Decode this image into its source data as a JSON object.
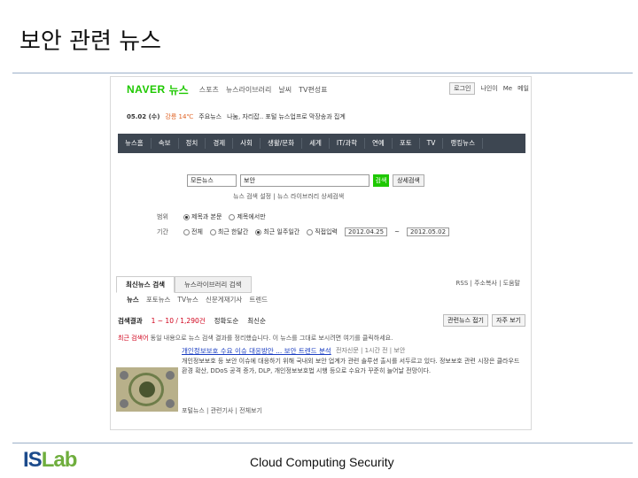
{
  "slide": {
    "title": "보안 관련 뉴스",
    "footer": "Cloud Computing Security",
    "logo_parts": [
      "IS",
      "Lab"
    ]
  },
  "naver": {
    "brand": "NAVER",
    "section": "뉴스",
    "top_nav": [
      "스포츠",
      "뉴스라이브러리",
      "날씨",
      "TV편성표"
    ],
    "top_right": [
      "로그인",
      "나인이",
      "Me",
      "메일"
    ],
    "date": "05.02 (수)",
    "weather_label": "강릉 14℃",
    "headline_prefix": "주요뉴스",
    "headline": "나눔, 자리잡.. 포털 뉴스업프로 막장송과 집계",
    "main_nav": [
      "뉴스홈",
      "속보",
      "정치",
      "경제",
      "사회",
      "생활/문화",
      "세계",
      "IT/과학",
      "연예",
      "포토",
      "TV",
      "랭킹뉴스"
    ],
    "search": {
      "scope": "모든뉴스",
      "query": "보안",
      "search_label": "검색",
      "detail_label": "상세검색",
      "links": "뉴스 검색 설정 | 뉴스 라이브러리 상세검색"
    },
    "filters": {
      "range_label": "범위",
      "range_options": [
        "제목과 본문",
        "제목에서만"
      ],
      "period_label": "기간",
      "period_options": [
        "전체",
        "최근 한달간",
        "최근 일주일간",
        "직접입력"
      ],
      "date_from": "2012.04.25",
      "date_sep": "~",
      "date_to": "2012.05.02"
    },
    "tabs": [
      "최신뉴스 검색",
      "뉴스라이브러리 검색"
    ],
    "tabs_right": "RSS | 주소복사 | 도움말",
    "subtabs": [
      "뉴스",
      "포토뉴스",
      "TV뉴스",
      "신문게재기사",
      "트렌드"
    ],
    "results": {
      "label": "검색결과",
      "count": "1 ~ 10 / 1,290건",
      "sort1": "정확도순",
      "sort2": "최신순",
      "buttons": [
        "관련뉴스 접기",
        "자주 보기"
      ]
    },
    "notice": {
      "highlight": "최근 검색어",
      "text": "동일 내용으로 뉴스 검색 결과를 정리했습니다. 이 뉴스를 그대로 보시려면 여기를 클릭하세요."
    },
    "article": {
      "title": "개인정보보호 수요 이슈 대응방안 ... 보안 트렌드 분석",
      "meta": "전자신문 | 1시간 전 | 보안",
      "body": "개인정보보호 등 보안 이슈에 대응하기 위해 국내외 보안 업계가 관련 솔루션 출시를 서두르고 있다. 정보보호 관련 시장은 클라우드 환경 확산, DDoS 공격 증가, DLP, 개인정보보호법 시행 등으로 수요가 꾸준히 늘어날 전망이다.",
      "links": "포털뉴스 | 관련기사 | 전체보기"
    }
  }
}
